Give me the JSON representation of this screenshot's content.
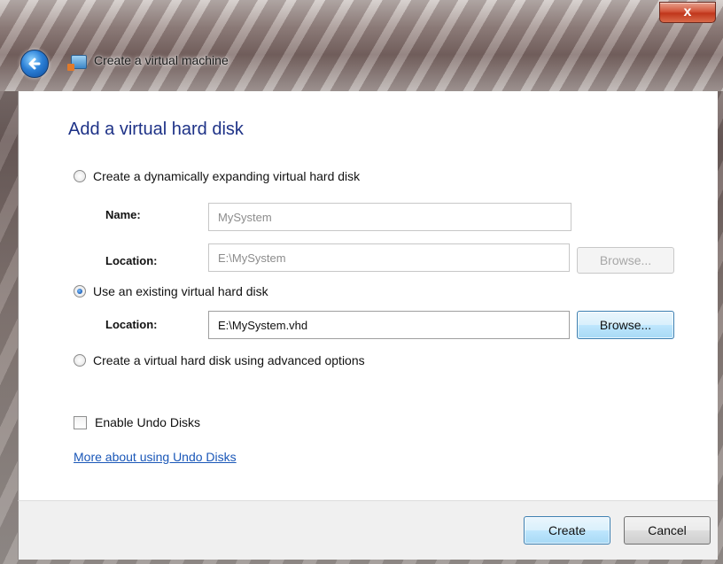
{
  "window": {
    "title": "Create a virtual machine",
    "close_glyph": "x",
    "back_icon": "back-arrow-icon",
    "app_icon": "virtual-pc-icon"
  },
  "page": {
    "heading": "Add a virtual hard disk"
  },
  "options": {
    "dynamic": {
      "label": "Create a dynamically expanding virtual hard disk",
      "checked": false,
      "name_label": "Name:",
      "name_value": "MySystem",
      "location_label": "Location:",
      "location_value": "E:\\MySystem",
      "browse_label": "Browse..."
    },
    "existing": {
      "label": "Use an existing virtual hard disk",
      "checked": true,
      "location_label": "Location:",
      "location_value": "E:\\MySystem.vhd",
      "browse_label": "Browse..."
    },
    "advanced": {
      "label": "Create a virtual hard disk using advanced options",
      "checked": false
    }
  },
  "undo": {
    "checkbox_label": "Enable Undo Disks",
    "checked": false,
    "help_link": "More about using Undo Disks"
  },
  "footer": {
    "create_label": "Create",
    "cancel_label": "Cancel"
  },
  "colors": {
    "heading": "#1e3287",
    "link": "#1a57b8",
    "close_button": "#c0361b"
  }
}
